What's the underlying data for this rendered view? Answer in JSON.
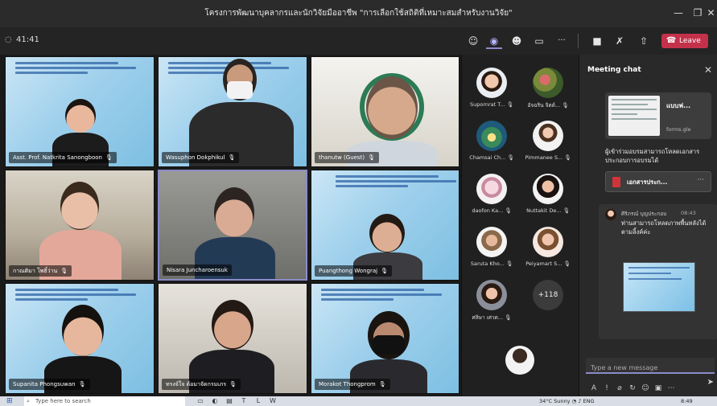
{
  "window": {
    "title": "โครงการพัฒนาบุคลากรและนักวิจัยมืออาชีพ \"การเลือกใช้สถิติที่เหมาะสมสำหรับงานวิจัย\"",
    "min_icon": "minimize-icon",
    "max_icon": "maximize-icon",
    "close_icon": "close-icon"
  },
  "toolbar": {
    "timer": "41:41",
    "more_label": "···",
    "leave_label": "Leave"
  },
  "tiles": [
    {
      "name": "Asst. Prof. Natkrita Sanongboon"
    },
    {
      "name": "Wasuphon Dokphikul"
    },
    {
      "name": "thanutw (Guest)"
    },
    {
      "name": "กาณติมา โพธิ์ว่าน"
    },
    {
      "name": "Nisara Juncharoensuk"
    },
    {
      "name": "Puangthong Wongraj"
    },
    {
      "name": "Supanita Phongsuwan"
    },
    {
      "name": "ทรงจ์ใจ ต้อมาจัดกรมเภร"
    },
    {
      "name": "Morakot Thongprom"
    }
  ],
  "participants": [
    {
      "name": "Supornrat T..."
    },
    {
      "name": "อัจฉริน จิตต์..."
    },
    {
      "name": "Chamsai Ch..."
    },
    {
      "name": "Pimmanee S..."
    },
    {
      "name": "daofon Ka..."
    },
    {
      "name": "Nuttakit De..."
    },
    {
      "name": "Saruta Kho..."
    },
    {
      "name": "Peiyamart S..."
    },
    {
      "name": "ศลิษา เศวต..."
    }
  ],
  "more_participants": "+118",
  "chat": {
    "header": "Meeting chat",
    "form_card_title": "แบบฟ...",
    "form_card_domain": "forms.gle",
    "message1": "ผู้เข้าร่วมอบรมสามารถโหลดเอกสารประกอบการอบรมได้",
    "file_name": "เอกสารประก...",
    "file_more": "···",
    "message2_sender": "ศิริภรณ์ บุญประกอบ",
    "message2_time": "08:43",
    "message2_text": "ท่านสามารถโหลดภาพพื้นหลังได้ตามลิ้งค์ค่ะ",
    "compose_placeholder": "Type a new message"
  },
  "taskbar": {
    "search_placeholder": "Type here to search",
    "weather": "34°C Sunny",
    "lang": "ENG",
    "time": "8:49"
  }
}
